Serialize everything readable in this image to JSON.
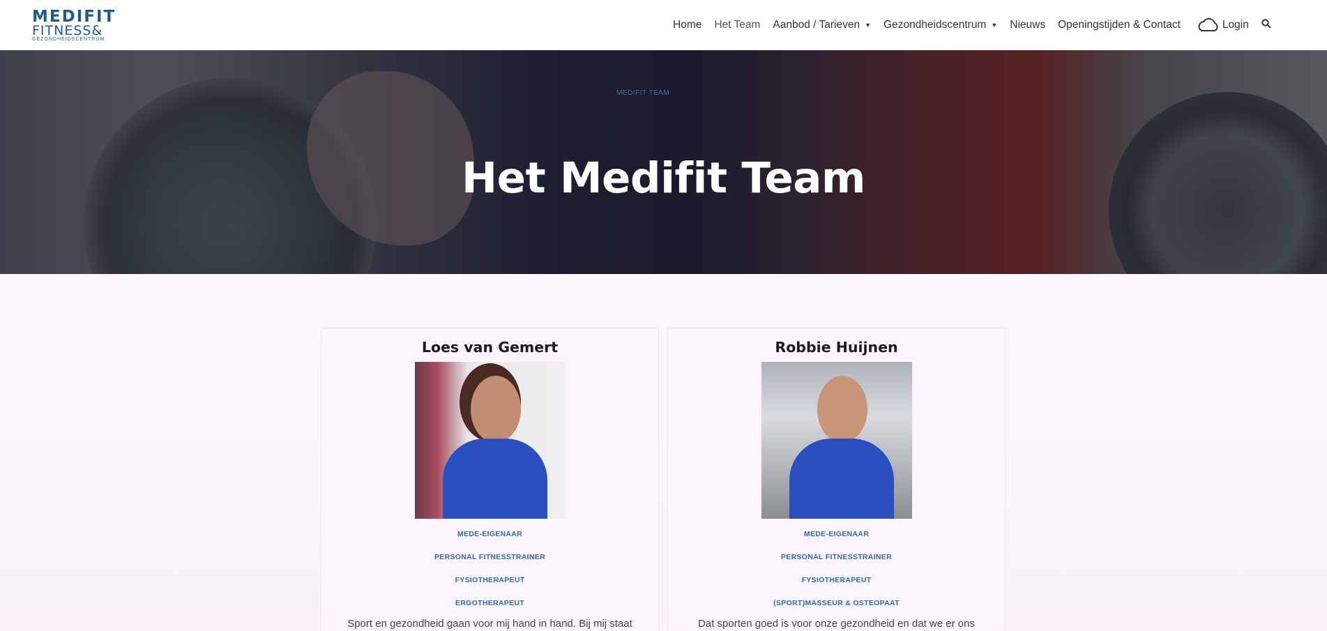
{
  "header": {
    "logo": {
      "line1": "MEDIFIT",
      "line2": "FITNESS&",
      "line3": "GEZONDHEIDSCENTRUM"
    },
    "nav": [
      {
        "label": "Home"
      },
      {
        "label": "Het Team",
        "active": true
      },
      {
        "label": "Aanbod / Tarieven",
        "has_dropdown": true
      },
      {
        "label": "Gezondheidscentrum",
        "has_dropdown": true
      },
      {
        "label": "Nieuws"
      },
      {
        "label": "Openingstijden & Contact"
      }
    ],
    "login_label": "Login",
    "login_icon": "cloud-icon",
    "search_icon": "search-icon"
  },
  "hero": {
    "breadcrumb": "MEDIFIT TEAM",
    "title": "Het Medifit Team"
  },
  "team": [
    {
      "name": "Loes van Gemert",
      "roles": [
        "MEDE-EIGENAAR",
        "PERSONAL FITNESSTRAINER",
        "FYSIOTHERAPEUT",
        "ERGOTHERAPEUT"
      ],
      "bio": "Sport en gezondheid gaan voor mij hand in hand. Bij mij staat"
    },
    {
      "name": "Robbie Huijnen",
      "roles": [
        "MEDE-EIGENAAR",
        "PERSONAL FITNESSTRAINER",
        "FYSIOTHERAPEUT",
        "(SPORT)MASSEUR & OSTEOPAAT"
      ],
      "bio": "Dat sporten goed is voor onze gezondheid en dat we er ons"
    }
  ],
  "colors": {
    "accent": "#2f6aa8",
    "brand": "#1f5a8a"
  }
}
